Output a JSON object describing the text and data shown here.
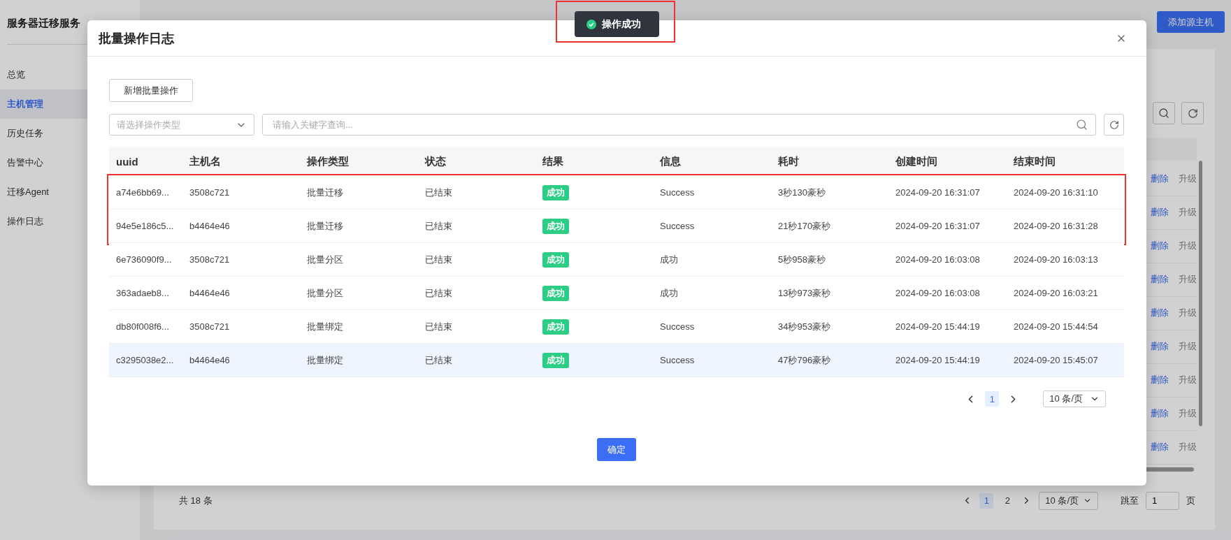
{
  "sidebar": {
    "title": "服务器迁移服务",
    "items": [
      {
        "label": "总览",
        "selected": false
      },
      {
        "label": "主机管理",
        "selected": true
      },
      {
        "label": "历史任务",
        "selected": false
      },
      {
        "label": "告警中心",
        "selected": false
      },
      {
        "label": "迁移Agent",
        "selected": false
      },
      {
        "label": "操作日志",
        "selected": false
      }
    ]
  },
  "page": {
    "add_button": "添加源主机",
    "row_actions": [
      {
        "delete": "删除",
        "upgrade": "升级"
      },
      {
        "delete": "删除",
        "upgrade": "升级"
      },
      {
        "delete": "删除",
        "upgrade": "升级"
      },
      {
        "delete": "删除",
        "upgrade": "升级"
      },
      {
        "delete": "删除",
        "upgrade": "升级"
      },
      {
        "delete": "删除",
        "upgrade": "升级"
      },
      {
        "delete": "删除",
        "upgrade": "升级"
      },
      {
        "delete": "删除",
        "upgrade": "升级"
      },
      {
        "delete": "删除",
        "upgrade": "升级"
      }
    ],
    "total": "共 18 条",
    "pagination": {
      "pages": [
        {
          "label": "1",
          "selected": true
        },
        {
          "label": "2",
          "selected": false
        }
      ],
      "page_size": "10 条/页",
      "jump_label": "跳至",
      "jump_value": "1",
      "page_suffix": "页"
    }
  },
  "dialog": {
    "title": "批量操作日志",
    "new_button": "新增批量操作",
    "type_select": {
      "placeholder": "请选择操作类型"
    },
    "search": {
      "placeholder": "请输入关键字查询..."
    },
    "table": {
      "columns": [
        "uuid",
        "主机名",
        "操作类型",
        "状态",
        "结果",
        "信息",
        "耗时",
        "创建时间",
        "结束时间"
      ],
      "rows": [
        {
          "uuid": "a74e6bb69...",
          "host": "3508c721",
          "type": "批量迁移",
          "status": "已结束",
          "result": "成功",
          "info": "Success",
          "duration": "3秒130豪秒",
          "created": "2024-09-20 16:31:07",
          "ended": "2024-09-20 16:31:10",
          "highlighted": true,
          "hovered": false
        },
        {
          "uuid": "94e5e186c5...",
          "host": "b4464e46",
          "type": "批量迁移",
          "status": "已结束",
          "result": "成功",
          "info": "Success",
          "duration": "21秒170豪秒",
          "created": "2024-09-20 16:31:07",
          "ended": "2024-09-20 16:31:28",
          "highlighted": true,
          "hovered": false
        },
        {
          "uuid": "6e736090f9...",
          "host": "3508c721",
          "type": "批量分区",
          "status": "已结束",
          "result": "成功",
          "info": "成功",
          "duration": "5秒958豪秒",
          "created": "2024-09-20 16:03:08",
          "ended": "2024-09-20 16:03:13",
          "highlighted": false,
          "hovered": false
        },
        {
          "uuid": "363adaeb8...",
          "host": "b4464e46",
          "type": "批量分区",
          "status": "已结束",
          "result": "成功",
          "info": "成功",
          "duration": "13秒973豪秒",
          "created": "2024-09-20 16:03:08",
          "ended": "2024-09-20 16:03:21",
          "highlighted": false,
          "hovered": false
        },
        {
          "uuid": "db80f008f6...",
          "host": "3508c721",
          "type": "批量绑定",
          "status": "已结束",
          "result": "成功",
          "info": "Success",
          "duration": "34秒953豪秒",
          "created": "2024-09-20 15:44:19",
          "ended": "2024-09-20 15:44:54",
          "highlighted": false,
          "hovered": false
        },
        {
          "uuid": "c3295038e2...",
          "host": "b4464e46",
          "type": "批量绑定",
          "status": "已结束",
          "result": "成功",
          "info": "Success",
          "duration": "47秒796豪秒",
          "created": "2024-09-20 15:44:19",
          "ended": "2024-09-20 15:45:07",
          "highlighted": false,
          "hovered": true
        }
      ]
    },
    "pagination": {
      "pages": [
        {
          "label": "1",
          "selected": true
        }
      ],
      "page_size": "10 条/页"
    },
    "confirm_button": "确定"
  },
  "toast": {
    "text": "操作成功",
    "highlighted": true
  }
}
